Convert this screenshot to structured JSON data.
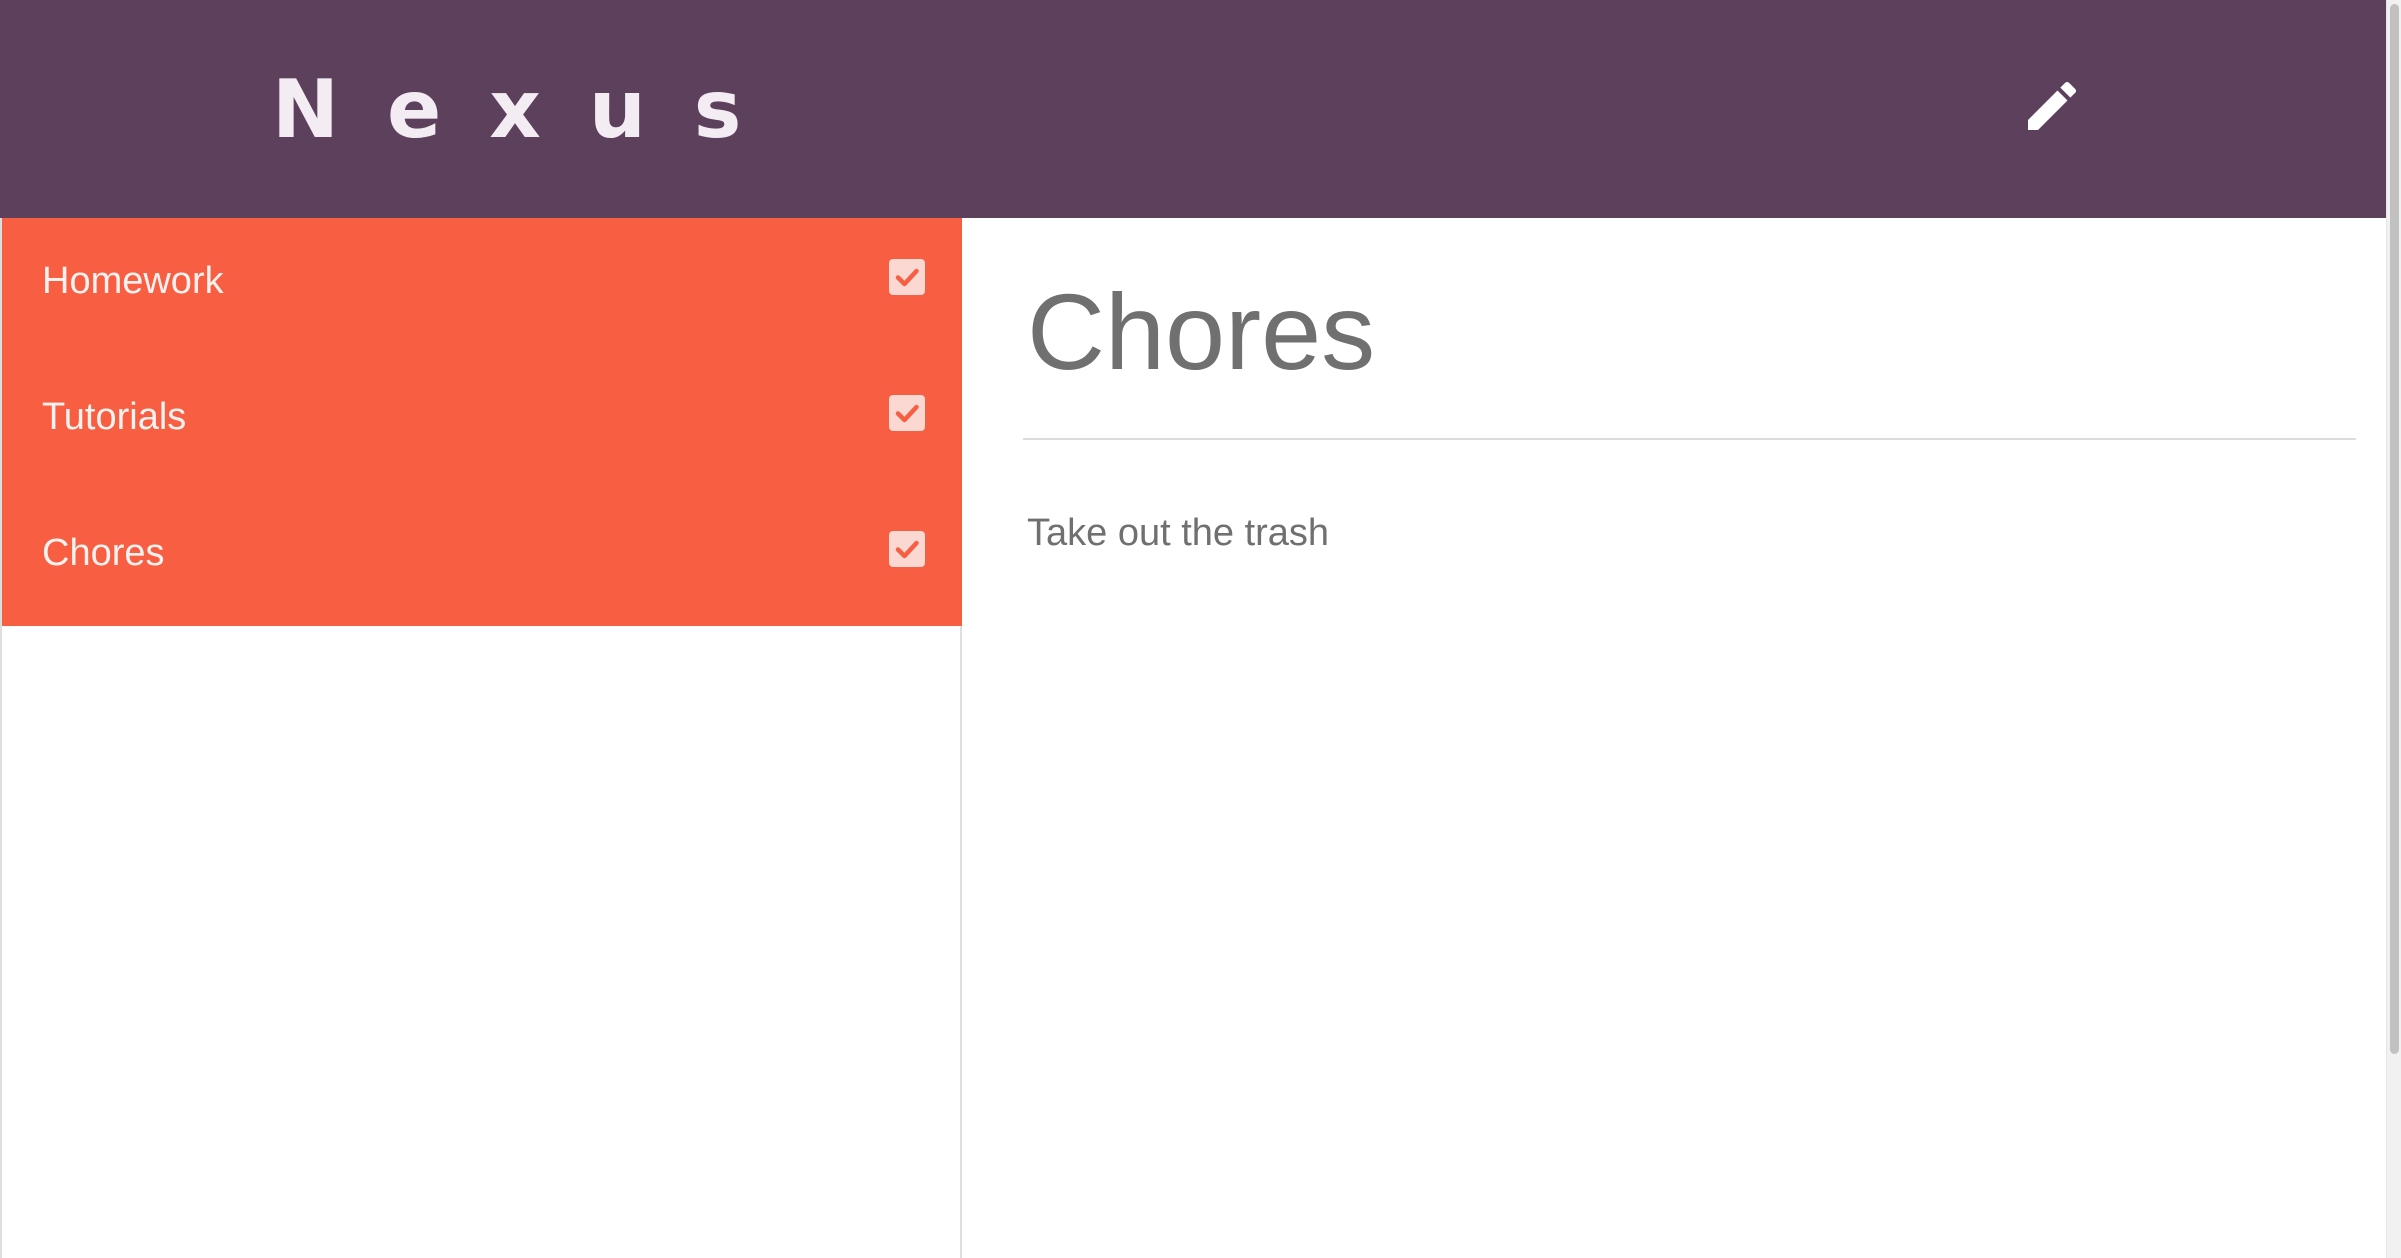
{
  "header": {
    "brand": "Nexus",
    "edit_icon": "pencil-icon",
    "background": "#5c405c"
  },
  "sidebar": {
    "background": "#f75e42",
    "items": [
      {
        "label": "Homework",
        "checked": true,
        "icon": "checkbox-checked-icon"
      },
      {
        "label": "Tutorials",
        "checked": true,
        "icon": "checkbox-checked-icon"
      },
      {
        "label": "Chores",
        "checked": true,
        "icon": "checkbox-checked-icon"
      }
    ]
  },
  "main": {
    "title": "Chores",
    "content": "Take out the trash"
  }
}
